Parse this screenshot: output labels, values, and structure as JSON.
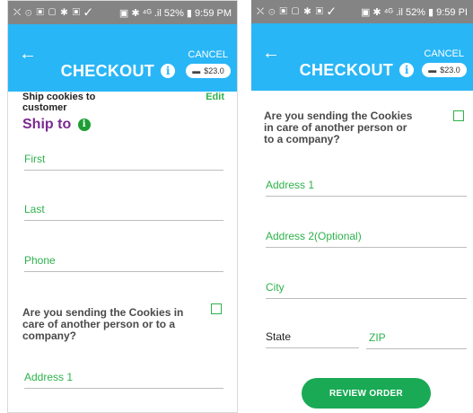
{
  "status_bar": {
    "left_icons": "⛌ ⊙ ▣ ▢ ✱ ▣ ✓",
    "right_text": "▣ ✱ ⁴ᴳ .il 52% ▮ 9:59 PM",
    "right_text_short": "▣ ✱ ⁴ᴳ .il 52% ▮ 9:59 PI"
  },
  "header": {
    "title": "CHECKOUT",
    "cancel_label": "CANCEL",
    "cart_total": "$23.0",
    "info_glyph": "i"
  },
  "left": {
    "ship_option": "Ship cookies to customer",
    "edit_label": "Edit",
    "ship_to_heading": "Ship to",
    "fields": {
      "first": "First",
      "last": "Last",
      "phone": "Phone",
      "address1": "Address 1"
    },
    "question": "Are you sending the Cookies in care of another person or to a company?"
  },
  "right": {
    "question": "Are you sending the Cookies in care of another person or to a company?",
    "fields": {
      "address1": "Address 1",
      "address2": "Address 2(Optional)",
      "city": "City",
      "state": "State",
      "zip": "ZIP"
    },
    "review_label": "REVIEW ORDER"
  },
  "colors": {
    "header_blue": "#29b6f6",
    "accent_green": "#2eb24b",
    "heading_purple": "#7b2a91",
    "button_green": "#1aaa55"
  }
}
